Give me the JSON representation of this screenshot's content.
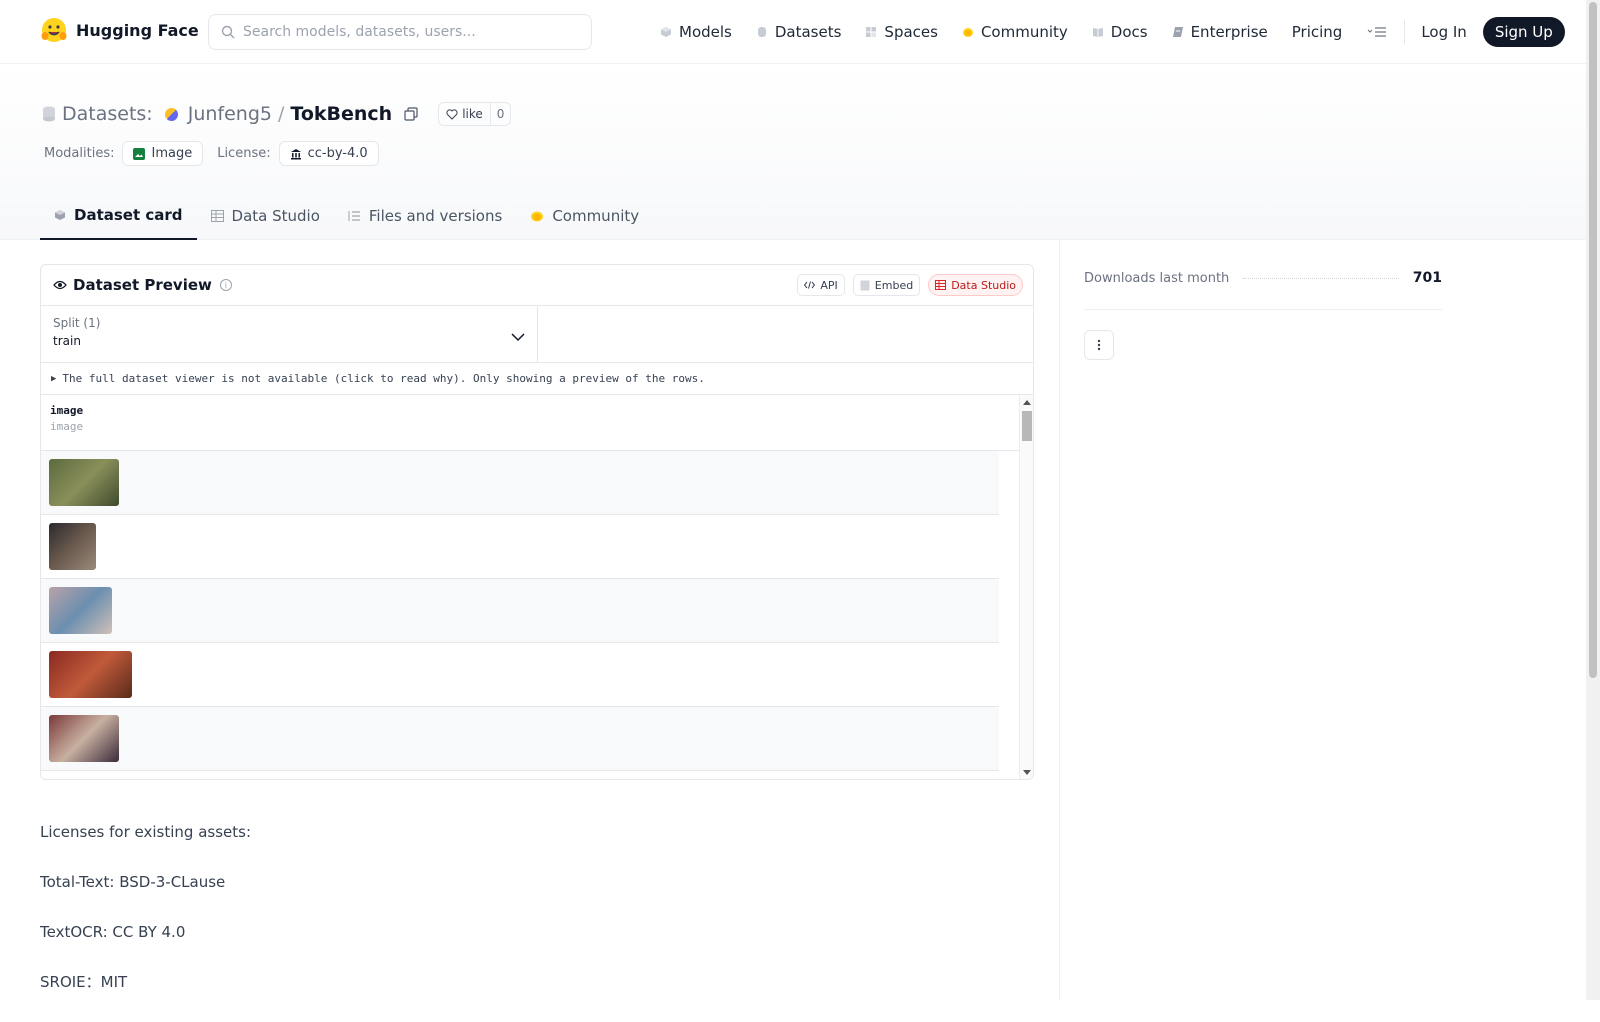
{
  "header": {
    "brand": "Hugging Face",
    "search_placeholder": "Search models, datasets, users...",
    "nav": [
      {
        "label": "Models",
        "icon": "cube-icon"
      },
      {
        "label": "Datasets",
        "icon": "database-icon"
      },
      {
        "label": "Spaces",
        "icon": "grid-icon"
      },
      {
        "label": "Community",
        "icon": "hand-icon"
      },
      {
        "label": "Docs",
        "icon": "book-icon"
      },
      {
        "label": "Enterprise",
        "icon": "enterprise-icon"
      },
      {
        "label": "Pricing",
        "icon": ""
      }
    ],
    "login": "Log In",
    "signup": "Sign Up"
  },
  "repo": {
    "kind": "Datasets:",
    "owner": "Junfeng5",
    "separator": "/",
    "name": "TokBench",
    "like_label": "like",
    "like_count": "0",
    "modalities_label": "Modalities:",
    "modality": "Image",
    "license_label": "License:",
    "license": "cc-by-4.0"
  },
  "tabs": [
    {
      "label": "Dataset card",
      "active": true
    },
    {
      "label": "Data Studio"
    },
    {
      "label": "Files and versions"
    },
    {
      "label": "Community"
    }
  ],
  "preview": {
    "title": "Dataset Preview",
    "api_label": "API",
    "embed_label": "Embed",
    "studio_label": "Data Studio",
    "split_label": "Split (1)",
    "split_value": "train",
    "notice": "The full dataset viewer is not available (click to read why). Only showing a preview of the rows.",
    "column_name": "image",
    "column_type": "image",
    "rows": [
      {
        "colors": [
          "#5b6b3e",
          "#8a8f5a",
          "#3e4a2c"
        ],
        "aspect": 1.49
      },
      {
        "colors": [
          "#2b2a2d",
          "#6b5a4e",
          "#9a8a7a"
        ],
        "aspect": 1.0
      },
      {
        "colors": [
          "#b8a2a8",
          "#6b8fb0",
          "#d0c0b8"
        ],
        "aspect": 1.34
      },
      {
        "colors": [
          "#8a2a22",
          "#c05a3a",
          "#5a2a1a"
        ],
        "aspect": 1.77
      },
      {
        "colors": [
          "#7a3a3a",
          "#c8b0a0",
          "#3a2a3a"
        ],
        "aspect": 1.49
      }
    ]
  },
  "card_text": [
    "Licenses for existing assets:",
    "Total-Text: BSD-3-CLause",
    "TextOCR: CC BY 4.0",
    "SROIE：MIT"
  ],
  "sidebar": {
    "downloads_label": "Downloads last month",
    "downloads_value": "701"
  },
  "colors": {
    "accent_dark": "#111827",
    "studio_red": "#b91c1c",
    "modality_green": "#15803d"
  }
}
